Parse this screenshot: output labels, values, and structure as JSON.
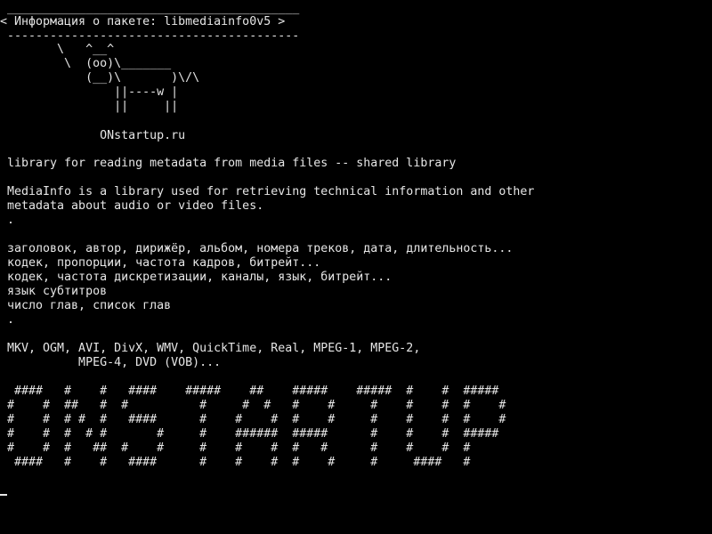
{
  "terminal": {
    "colors": {
      "background": "#000000",
      "foreground": "#e6e6e6"
    },
    "lines": [
      " _________________________________________",
      "< Информация о пакете: libmediainfo0v5 >",
      " -----------------------------------------",
      "        \\   ^__^",
      "         \\  (oo)\\_______",
      "            (__)\\       )\\/\\",
      "                ||----w |",
      "                ||     ||",
      "",
      "              ONstartup.ru",
      "",
      " library for reading metadata from media files -- shared library",
      "",
      " MediaInfo is a library used for retrieving technical information and other",
      " metadata about audio or video files.",
      " .",
      "",
      " заголовок, автор, дирижёр, альбом, номера треков, дата, длительность...",
      " кодек, пропорции, частота кадров, битрейт...",
      " кодек, частота дискретизации, каналы, язык, битрейт...",
      " язык субтитров",
      " число глав, список глав",
      " .",
      "",
      " MKV, OGM, AVI, DivX, WMV, QuickTime, Real, MPEG-1, MPEG-2,",
      "           MPEG-4, DVD (VOB)...",
      "",
      "  ####   #    #   ####    #####    ##    #####    #####  #    #  #####",
      " #    #  ##   #  #          #     #  #   #    #     #    #    #  #    #",
      " #    #  # #  #   ####      #    #    #  #    #     #    #    #  #    #",
      " #    #  #  # #       #     #    ######  #####      #    #    #  #####",
      " #    #  #   ##  #    #     #    #    #  #   #      #    #    #  #",
      "  ####   #    #   ####      #    #    #  #    #     #     ####   #"
    ]
  }
}
